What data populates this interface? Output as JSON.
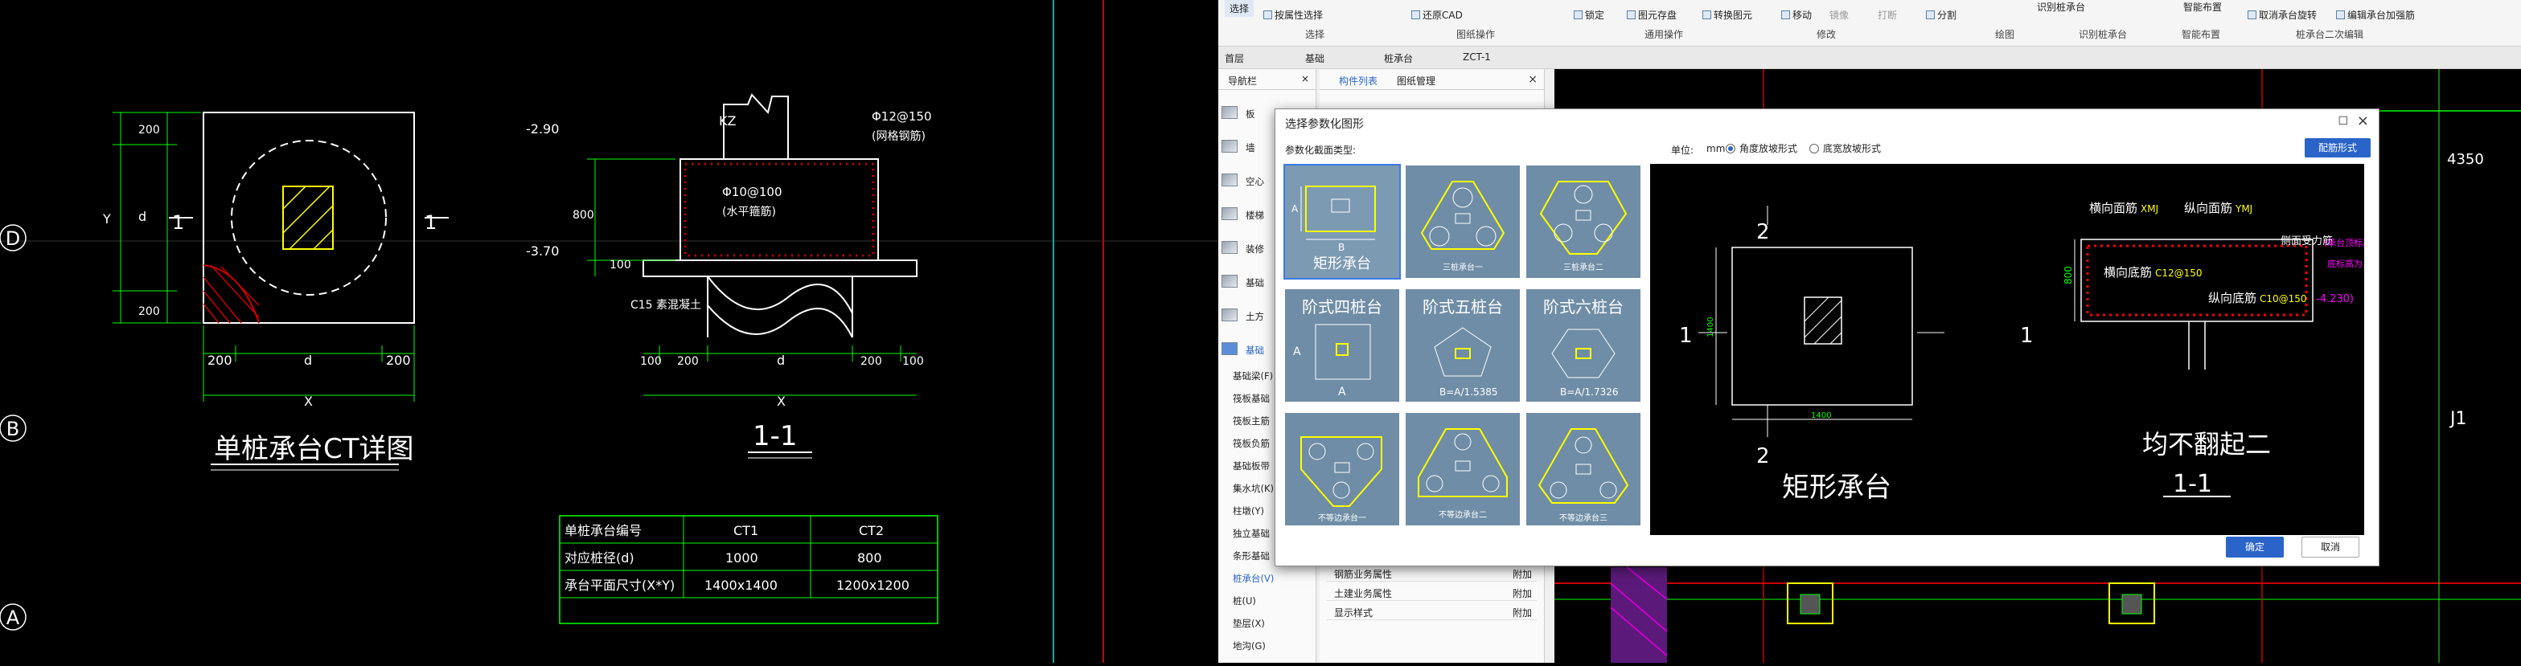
{
  "left_drawing": {
    "detail_title": "单桩承台CT详图",
    "section_title": "1-1",
    "axis_labels": [
      "D",
      "B",
      "A"
    ],
    "dim_200": "200",
    "dim_d": "d",
    "dim_x": "X",
    "dim_y": "Y",
    "section_mark": "1",
    "section_dims": {
      "elev_top": "-2.90",
      "elev_bottom": "-3.70",
      "dim_800": "800",
      "dim_100": "100",
      "dim_200": "200",
      "dim_d": "d",
      "dim_x": "X"
    },
    "labels": {
      "kz": "KZ",
      "rebar_top": "Φ12@150",
      "rebar_top_note": "(网格钢筋)",
      "rebar_side": "Φ10@100",
      "rebar_side_note": "(水平箍筋)",
      "c15": "C15 素混凝土"
    },
    "table": {
      "headers": [
        "单桩承台编号",
        "CT1",
        "CT2"
      ],
      "rows": [
        [
          "对应桩径(d)",
          "1000",
          "800"
        ],
        [
          "承台平面尺寸(X*Y)",
          "1400x1400",
          "1200x1200"
        ]
      ]
    }
  },
  "ribbon": {
    "select": "选择",
    "select_sub": "按属性选择",
    "select_group": "选择",
    "restore_cad": "还原CAD",
    "drawing_ops": "图纸操作",
    "lock": "锁定",
    "save_element": "图元存盘",
    "convert_element": "转换图元",
    "general_ops": "通用操作",
    "move": "移动",
    "mirror": "镜像",
    "break": "打断",
    "split": "分割",
    "modify": "修改",
    "draw": "绘图",
    "identify_cap": "识别桩承台",
    "identify_group": "识别桩承台",
    "smart_layout": "智能布置",
    "smart_group": "智能布置",
    "cancel_rotate": "取消承台旋转",
    "edit_rebar": "编辑承台加强筋",
    "secondary_edit": "桩承台二次编辑"
  },
  "crumb": {
    "floor": "首层",
    "cat": "基础",
    "type": "桩承台",
    "item": "ZCT-1"
  },
  "nav": {
    "header": "导航栏",
    "items": [
      "板",
      "墙",
      "空心",
      "楼梯",
      "装修",
      "基础",
      "土方",
      "基础"
    ],
    "sub_items": [
      "基础梁(F)",
      "筏板基础",
      "筏板主筋",
      "筏板负筋",
      "基础板带",
      "集水坑(K)",
      "柱墩(Y)",
      "独立基础",
      "条形基础",
      "桩承台(V)",
      "桩(U)",
      "垫层(X)",
      "地沟(G)"
    ],
    "active_sub": "桩承台(V)"
  },
  "list_panel": {
    "tab_list": "构件列表",
    "tab_drawings": "图纸管理",
    "props": [
      {
        "label": "钢筋业务属性",
        "value": "附加"
      },
      {
        "label": "土建业务属性",
        "value": "附加"
      },
      {
        "label": "显示样式",
        "value": "附加"
      }
    ]
  },
  "right_drawing": {
    "dim_4350": "4350",
    "j1": "J1"
  },
  "dialog": {
    "title": "选择参数化图形",
    "type_label": "参数化截面类型:",
    "unit_label": "单位:",
    "unit": "mm",
    "radio_angle": "角度放坡形式",
    "radio_width": "底宽放坡形式",
    "config_button": "配筋形式",
    "ok": "确定",
    "cancel": "取消",
    "thumbnails": [
      {
        "caption": "矩形承台",
        "selected": true
      },
      {
        "caption": "三桩承台一",
        "selected": false
      },
      {
        "caption": "三桩承台二",
        "selected": false
      },
      {
        "caption": "阶式四桩台",
        "selected": false
      },
      {
        "caption": "阶式五桩台",
        "selected": false
      },
      {
        "caption": "阶式六桩台",
        "selected": false
      },
      {
        "caption": "不等边承台一",
        "selected": false
      },
      {
        "caption": "不等边承台二",
        "selected": false
      },
      {
        "caption": "不等边承台三",
        "selected": false
      }
    ],
    "thumb_dims": {
      "a": "A",
      "b": "B",
      "five": "B=A/1.5385",
      "six": "B=A/1.7326"
    },
    "preview": {
      "plan_title": "矩形承台",
      "section_mark": "1",
      "section_mark_2": "2",
      "dim_1400": "1400",
      "section_title": "均不翻起二",
      "section_sub": "1-1",
      "dim_800": "800",
      "labels": {
        "top_h": "横向面筋",
        "top_h_val": "XMJ",
        "top_v": "纵向面筋",
        "top_v_val": "YMJ",
        "side": "侧面受力筋",
        "bot_h": "横向底筋",
        "bot_h_val": "C12@150",
        "bot_v": "纵向底筋",
        "bot_v_val": "C10@150",
        "note1": "(承台顶标高参照承台",
        "note2": "底标高为",
        "elev": "-4.230)"
      }
    }
  }
}
